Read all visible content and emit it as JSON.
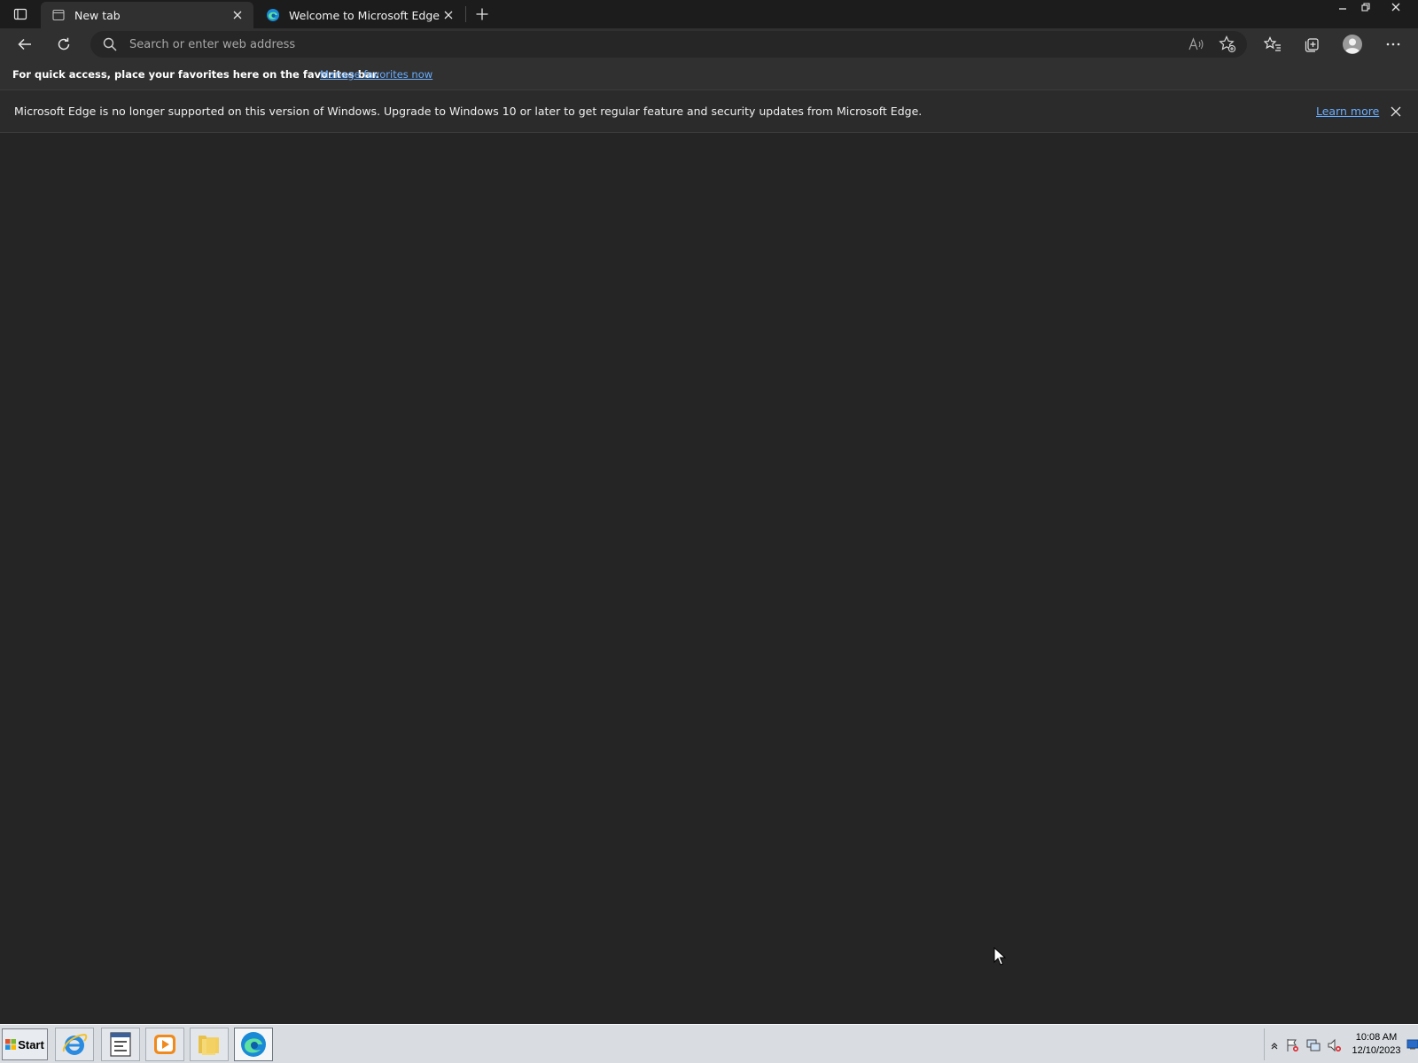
{
  "browser": {
    "tabs": [
      {
        "label": "New tab",
        "active": true
      },
      {
        "label": "Welcome to Microsoft Edge",
        "active": false
      }
    ],
    "address_bar": {
      "placeholder": "Search or enter web address",
      "value": ""
    },
    "favorites_bar": {
      "text": "For quick access, place your favorites here on the favorites bar.",
      "link": "Manage favorites now"
    },
    "info_bar": {
      "message": "Microsoft Edge is no longer supported on this version of Windows. Upgrade to Windows 10 or later to get regular feature and security updates from Microsoft Edge.",
      "link": "Learn more"
    }
  },
  "taskbar": {
    "start_label": "Start",
    "clock": {
      "time": "10:08 AM",
      "date": "12/10/2023"
    }
  },
  "colors": {
    "chrome_dark": "#1c1c1c",
    "toolbar": "#303030",
    "page_background": "#252525",
    "link": "#6aaeff",
    "taskbar": "#d9dde2"
  },
  "icons": {
    "toolbar": [
      "back-arrow-icon",
      "refresh-icon",
      "search-icon",
      "read-aloud-icon",
      "add-favorite-icon",
      "favorites-icon",
      "collections-icon",
      "profile-icon",
      "more-icon"
    ],
    "taskbar_apps": [
      "internet-explorer-icon",
      "server-manager-icon",
      "media-player-icon",
      "file-explorer-icon",
      "edge-icon"
    ]
  }
}
